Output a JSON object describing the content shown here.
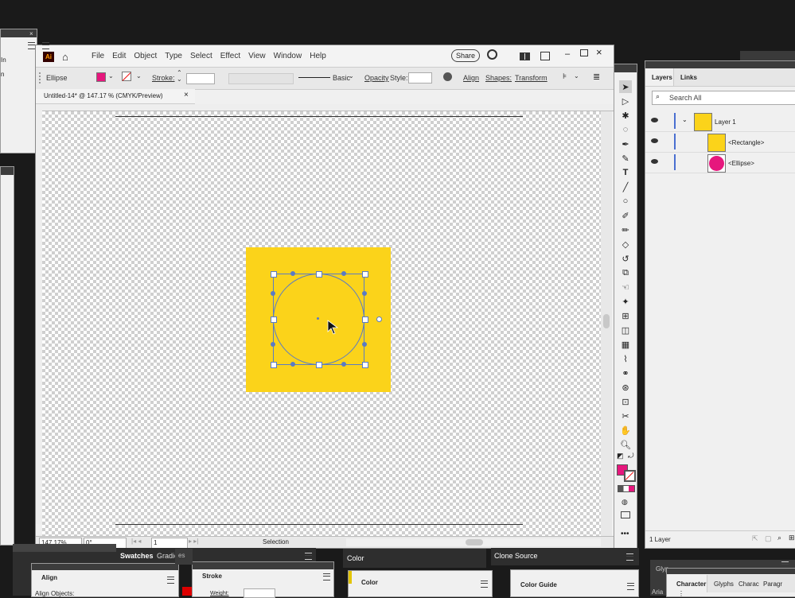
{
  "app": {
    "logo": "Ai",
    "menu": [
      "File",
      "Edit",
      "Object",
      "Type",
      "Select",
      "Effect",
      "View",
      "Window",
      "Help"
    ],
    "share_label": "Share"
  },
  "control_bar": {
    "selection_type": "Ellipse",
    "fill_color": "#e6177d",
    "stroke_label": "Stroke:",
    "stroke_style": "Basic",
    "opacity_label": "Opacity",
    "style_label": "Style:",
    "align_label": "Align",
    "shapes_label": "Shapes:",
    "transform_label": "Transform"
  },
  "document": {
    "tab_title": "Untitled-14* @ 147.17 % (CMYK/Preview)",
    "close_glyph": "×"
  },
  "artwork": {
    "rectangle_color": "#fbd31a",
    "ellipse_color": "#fbd31a",
    "selection_color": "#5a7bc4"
  },
  "status_bar": {
    "zoom": "147.17%",
    "rotation": "0°",
    "artboard": "1",
    "tool": "Selection"
  },
  "layers_panel": {
    "tabs": [
      "Layers",
      "Links"
    ],
    "search_placeholder": "Search All",
    "rows": [
      {
        "name": "Layer 1",
        "swatch": "#fbd31a"
      },
      {
        "name": "<Rectangle>",
        "swatch": "#fbd31a"
      },
      {
        "name": "<Ellipse>",
        "swatch": "#e6177d"
      }
    ],
    "footer": "1 Layer"
  },
  "bottom_panels": {
    "swatches_tab": "Swatches",
    "gradients_tab": "Gradients",
    "color_tab": "Color",
    "clone_source_tab": "Clone Source",
    "align_title": "Align",
    "align_sub": "Align Objects:",
    "stroke_title": "Stroke",
    "stroke_weight_label": "Weight:",
    "color_title": "Color",
    "color_guide_title": "Color Guide",
    "character_tab": "Character",
    "glyphs_tab": "Glyphs",
    "charac_tab": "Charac",
    "paragr_tab": "Paragr",
    "glyphs_partial": "Glyp",
    "arial_partial": "Aria",
    "es_partial": "es"
  },
  "left_panel_partials": {
    "line1": "In",
    "line2": "n"
  },
  "tools": {
    "fill_color": "#e6177d"
  }
}
